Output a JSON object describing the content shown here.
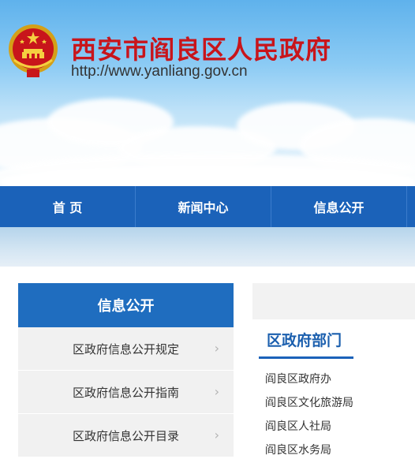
{
  "header": {
    "title": "西安市阎良区人民政府",
    "url": "http://www.yanliang.gov.cn",
    "emblem_icon": "national-emblem-icon"
  },
  "nav": {
    "items": [
      {
        "label": "首 页"
      },
      {
        "label": "新闻中心"
      },
      {
        "label": "信息公开"
      }
    ]
  },
  "sidebar": {
    "title": "信息公开",
    "items": [
      {
        "label": "区政府信息公开规定"
      },
      {
        "label": "区政府信息公开指南"
      },
      {
        "label": "区政府信息公开目录"
      }
    ],
    "chevron_icon": "chevron-right-icon"
  },
  "departments": {
    "title": "区政府部门",
    "items": [
      {
        "label": "阎良区政府办"
      },
      {
        "label": "阎良区文化旅游局"
      },
      {
        "label": "阎良区人社局"
      },
      {
        "label": "阎良区水务局"
      }
    ]
  },
  "colors": {
    "title_red": "#c8151b",
    "nav_blue": "#1b62b9",
    "accent_blue": "#1f6dbf"
  }
}
